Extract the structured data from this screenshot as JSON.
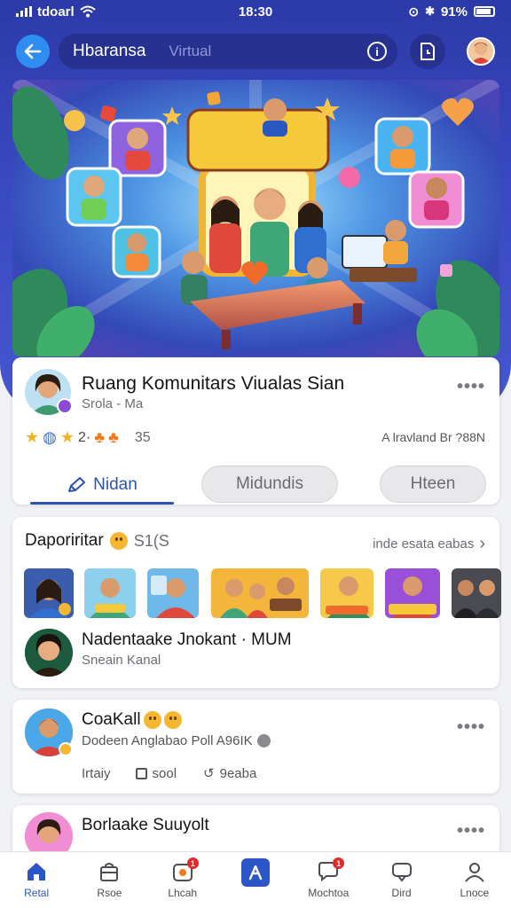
{
  "status_bar": {
    "carrier": "tdoarl",
    "time": "18:30",
    "battery": "91%"
  },
  "topbar": {
    "search_title": "Hbaransa",
    "search_hint": "Virtual",
    "info_glyph": "i"
  },
  "community_card": {
    "name": "Ruang Komunitars Viualas Sian",
    "subtitle": "Srola - Ma",
    "more_glyph": "••••",
    "meta_numbers": "2·",
    "meta_count": "35",
    "meta_right": "A lravland Br ?88N",
    "tabs": {
      "active": "Nidan",
      "pill_1": "Midundis",
      "pill_2": "Hteen"
    }
  },
  "discover_card": {
    "title": "Daporiritar",
    "count": "S1(S",
    "see_all": "inde esata eabas",
    "chevron": "›",
    "featured_title": "Nadentaake Jnokant · MUM",
    "featured_sub": "Sneain Kanal"
  },
  "post_card": {
    "author": "CoaKall",
    "line": "Dodeen Anglabao Poll A96IK",
    "more_glyph": "••••",
    "action_1": "Irtaiy",
    "action_2": "sool",
    "action_3": "9eaba"
  },
  "post_card_2": {
    "author": "Borlaake Suuyolt",
    "more_glyph": "••••"
  },
  "bottom_nav": {
    "items": [
      {
        "label": "Retal",
        "icon": "home-icon"
      },
      {
        "label": "Rsoe",
        "icon": "bag-icon"
      },
      {
        "label": "Lhcah",
        "icon": "camera-icon",
        "badge": "1"
      },
      {
        "label": "",
        "icon": "center-app-icon"
      },
      {
        "label": "Mochtoa",
        "icon": "chat-icon",
        "badge": "1"
      },
      {
        "label": "Dird",
        "icon": "message-icon"
      },
      {
        "label": "Lnoce",
        "icon": "profile-icon"
      }
    ]
  },
  "colors": {
    "header_bg": "#3a49c2",
    "accent": "#2c56c8",
    "back_button": "#2f8df2",
    "badge": "#e3282a"
  }
}
